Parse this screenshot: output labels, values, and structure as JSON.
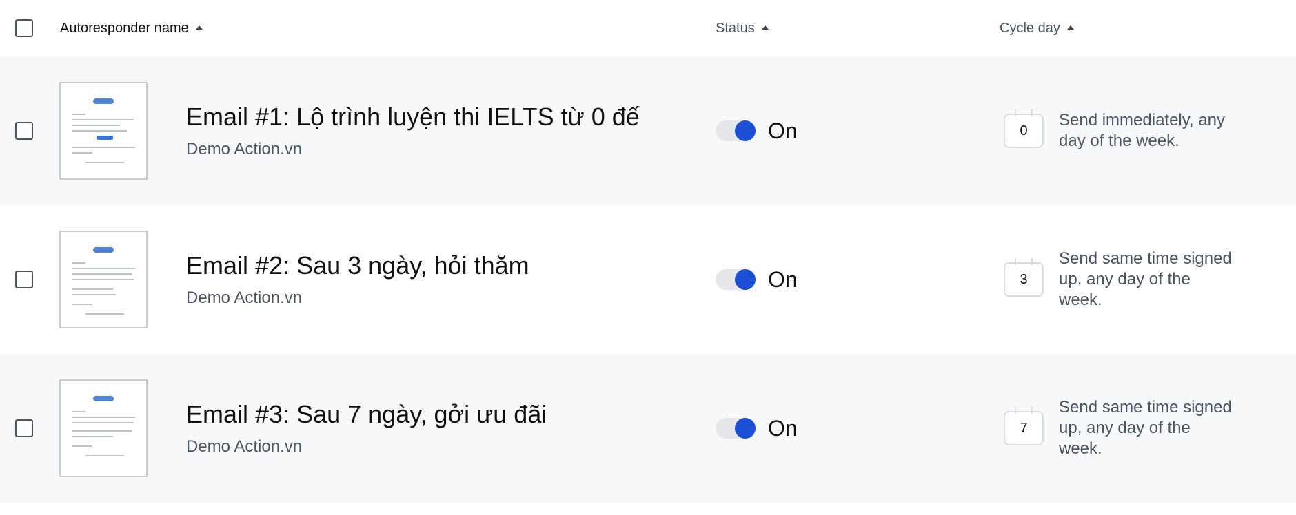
{
  "header": {
    "name_label": "Autoresponder name",
    "status_label": "Status",
    "cycle_label": "Cycle day"
  },
  "rows": [
    {
      "title": "Email #1: Lộ trình luyện thi IELTS từ 0 đế",
      "subtitle": "Demo Action.vn",
      "status": "On",
      "cycle_day": "0",
      "cycle_text": "Send immediately, any day of the week."
    },
    {
      "title": "Email #2: Sau 3 ngày, hỏi thăm",
      "subtitle": "Demo Action.vn",
      "status": "On",
      "cycle_day": "3",
      "cycle_text": "Send same time signed up, any day of the week."
    },
    {
      "title": "Email #3: Sau 7 ngày, gởi ưu đãi",
      "subtitle": "Demo Action.vn",
      "status": "On",
      "cycle_day": "7",
      "cycle_text": "Send same time signed up, any day of the week."
    }
  ],
  "colors": {
    "toggle_on": "#1a4fd6",
    "row_shade": "#f7f8fa",
    "muted_text": "#4b5563"
  }
}
